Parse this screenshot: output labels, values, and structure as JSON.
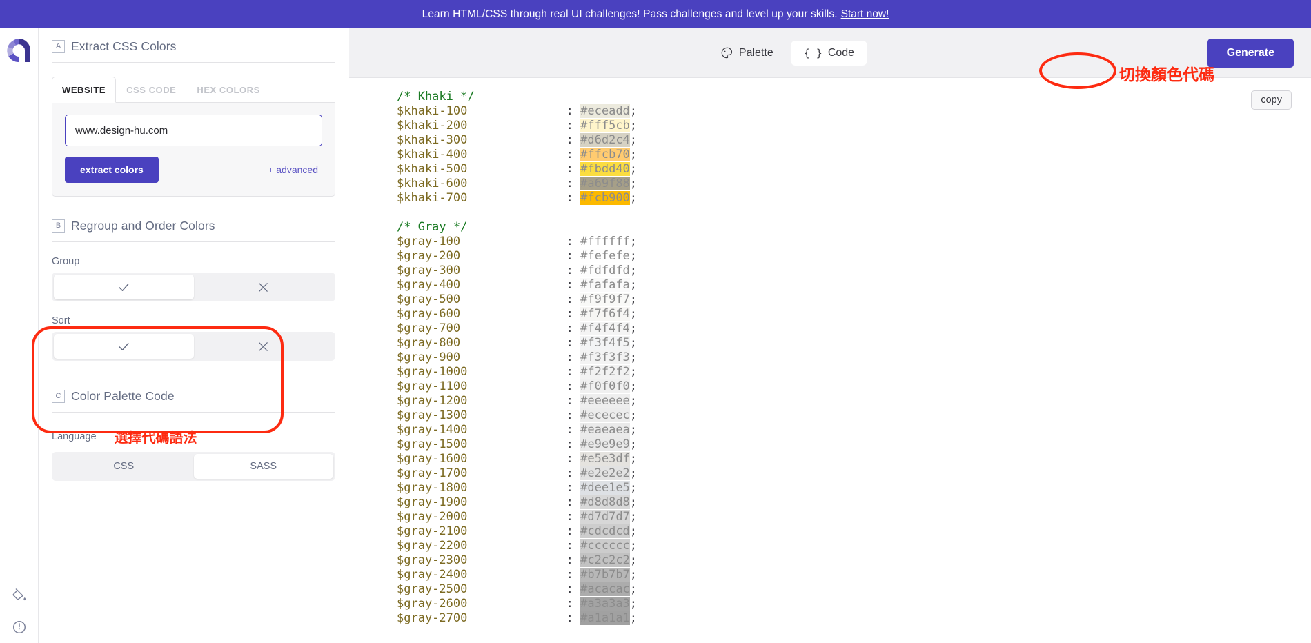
{
  "banner": {
    "text": "Learn HTML/CSS through real UI challenges! Pass challenges and level up your skills.",
    "link_label": "Start now!",
    "bg_color": "#4a41bf"
  },
  "rail": {
    "logo_name": "app-logo",
    "bottom_icons": [
      "paint-bucket-icon",
      "contrast-circle-icon"
    ]
  },
  "sidebar": {
    "section_a": {
      "badge": "A",
      "title": "Extract CSS Colors",
      "tabs": [
        {
          "label": "WEBSITE",
          "active": true
        },
        {
          "label": "CSS CODE",
          "active": false
        },
        {
          "label": "HEX COLORS",
          "active": false
        }
      ],
      "url_value": "www.design-hu.com",
      "url_placeholder": "www.design-hu.com",
      "extract_button": "extract colors",
      "advanced_link": "+ advanced"
    },
    "section_b": {
      "badge": "B",
      "title": "Regroup and Order Colors",
      "group_label": "Group",
      "sort_label": "Sort",
      "group_selected": "check",
      "sort_selected": "check",
      "options": [
        "check",
        "cross"
      ]
    },
    "section_c": {
      "badge": "C",
      "title": "Color Palette Code",
      "language_label": "Language",
      "annotation_cn": "選擇代碼語法",
      "languages": [
        {
          "label": "CSS",
          "selected": false
        },
        {
          "label": "SASS",
          "selected": true
        }
      ],
      "annotation_color": "#fd2b11"
    }
  },
  "main": {
    "tabs": [
      {
        "label": "Palette",
        "icon": "palette-icon",
        "active": false
      },
      {
        "label": "Code",
        "icon": "braces-icon",
        "active": true
      }
    ],
    "annotation_cn": "切換顏色代碼",
    "generate_button": "Generate",
    "copy_button": "copy"
  },
  "code": {
    "language": "SASS",
    "groups": [
      {
        "comment": "/* Khaki */",
        "entries": [
          {
            "name": "$khaki-100",
            "value": "#eceadd"
          },
          {
            "name": "$khaki-200",
            "value": "#fff5cb"
          },
          {
            "name": "$khaki-300",
            "value": "#d6d2c4"
          },
          {
            "name": "$khaki-400",
            "value": "#ffcb70"
          },
          {
            "name": "$khaki-500",
            "value": "#fbdd40"
          },
          {
            "name": "$khaki-600",
            "value": "#a69f88"
          },
          {
            "name": "$khaki-700",
            "value": "#fcb900"
          }
        ]
      },
      {
        "comment": "/* Gray */",
        "entries": [
          {
            "name": "$gray-100",
            "value": "#ffffff"
          },
          {
            "name": "$gray-200",
            "value": "#fefefe"
          },
          {
            "name": "$gray-300",
            "value": "#fdfdfd"
          },
          {
            "name": "$gray-400",
            "value": "#fafafa"
          },
          {
            "name": "$gray-500",
            "value": "#f9f9f7"
          },
          {
            "name": "$gray-600",
            "value": "#f7f6f4"
          },
          {
            "name": "$gray-700",
            "value": "#f4f4f4"
          },
          {
            "name": "$gray-800",
            "value": "#f3f4f5"
          },
          {
            "name": "$gray-900",
            "value": "#f3f3f3"
          },
          {
            "name": "$gray-1000",
            "value": "#f2f2f2"
          },
          {
            "name": "$gray-1100",
            "value": "#f0f0f0"
          },
          {
            "name": "$gray-1200",
            "value": "#eeeeee"
          },
          {
            "name": "$gray-1300",
            "value": "#ececec"
          },
          {
            "name": "$gray-1400",
            "value": "#eaeaea"
          },
          {
            "name": "$gray-1500",
            "value": "#e9e9e9"
          },
          {
            "name": "$gray-1600",
            "value": "#e5e3df"
          },
          {
            "name": "$gray-1700",
            "value": "#e2e2e2"
          },
          {
            "name": "$gray-1800",
            "value": "#dee1e5"
          },
          {
            "name": "$gray-1900",
            "value": "#d8d8d8"
          },
          {
            "name": "$gray-2000",
            "value": "#d7d7d7"
          },
          {
            "name": "$gray-2100",
            "value": "#cdcdcd"
          },
          {
            "name": "$gray-2200",
            "value": "#cccccc"
          },
          {
            "name": "$gray-2300",
            "value": "#c2c2c2"
          },
          {
            "name": "$gray-2400",
            "value": "#b7b7b7"
          },
          {
            "name": "$gray-2500",
            "value": "#acacac"
          },
          {
            "name": "$gray-2600",
            "value": "#a3a3a3"
          },
          {
            "name": "$gray-2700",
            "value": "#a1a1a1"
          }
        ]
      }
    ]
  }
}
